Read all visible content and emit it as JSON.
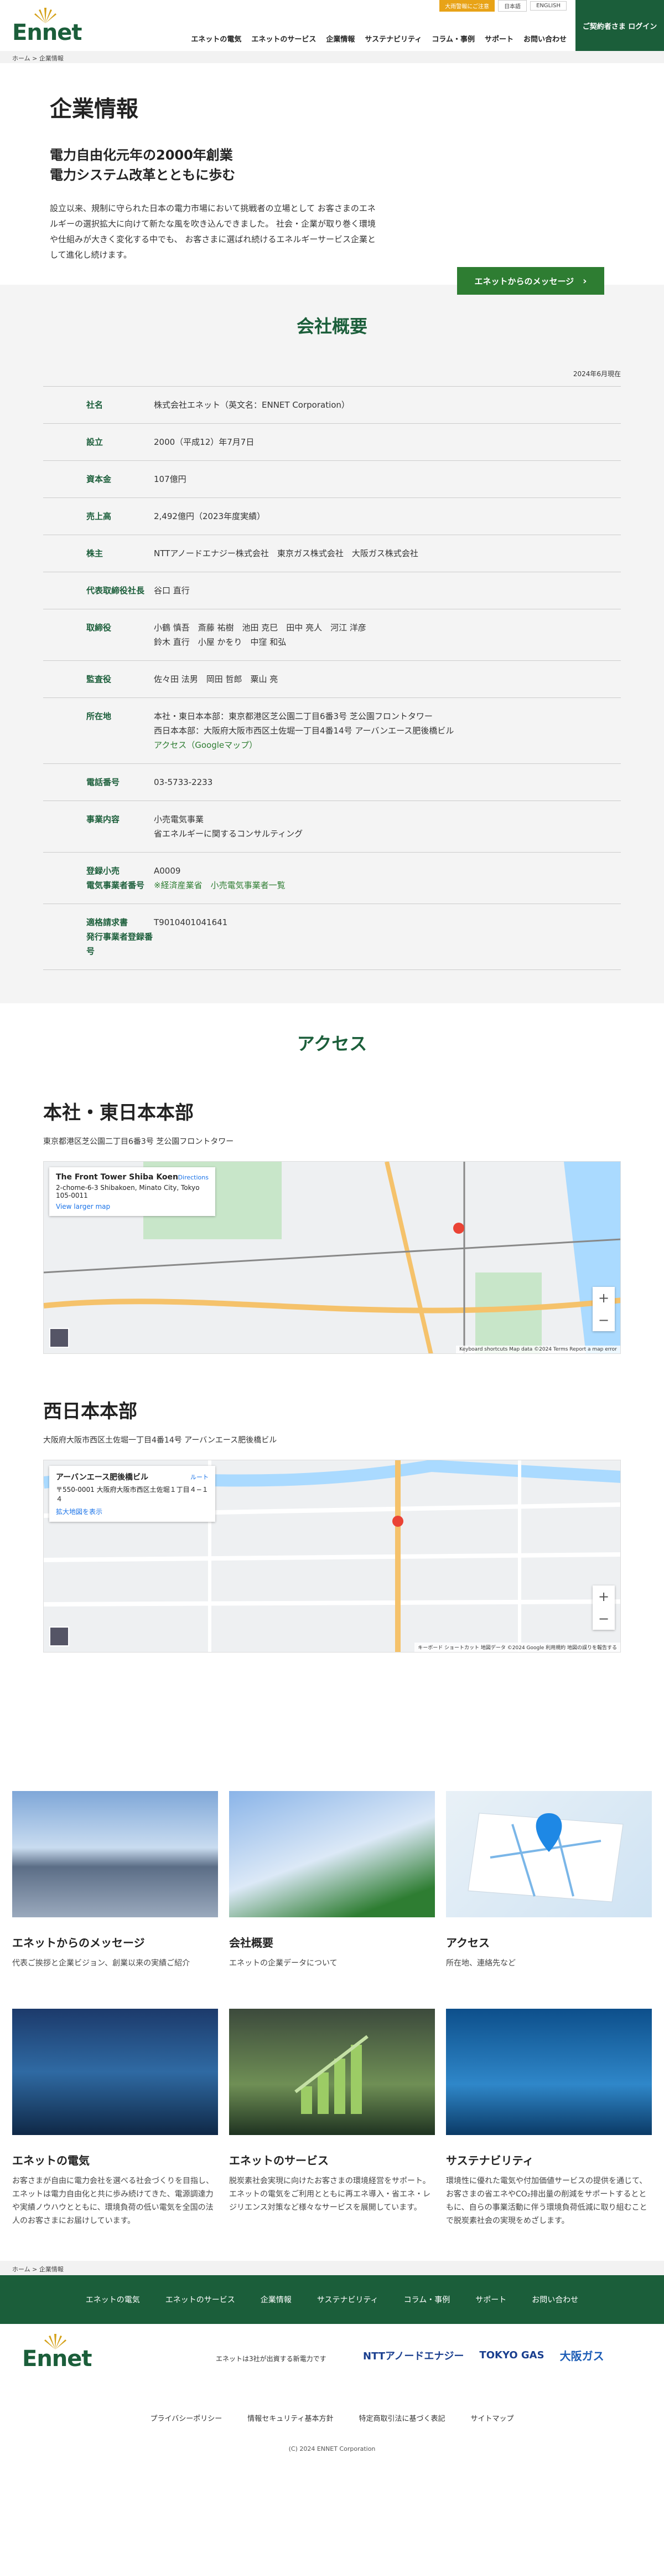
{
  "header": {
    "logo_text": "Ennet",
    "top_notice": "大雨警報にご注意",
    "lang_jp": "日本語",
    "lang_en": "ENGLISH",
    "nav": [
      "エネットの電気",
      "エネットのサービス",
      "企業情報",
      "サステナビリティ",
      "コラム・事例",
      "サポート",
      "お問い合わせ"
    ],
    "login": "ご契約者さま ログイン"
  },
  "breadcrumb": {
    "home": "ホーム",
    "sep": ">",
    "current": "企業情報"
  },
  "hero": {
    "title": "企業情報",
    "subtitle1": "電力自由化元年の2000年創業",
    "subtitle2": "電力システム改革とともに歩む",
    "body": "設立以来、規制に守られた日本の電力市場において挑戦者の立場として お客さまのエネルギーの選択拡大に向けて新たな風を吹き込んできました。 社会・企業が取り巻く環境や仕組みが大きく変化する中でも、 お客さまに選ばれ続けるエネルギーサービス企業として進化し続けます。",
    "button": "エネットからのメッセージ"
  },
  "overview": {
    "title": "会社概要",
    "date": "2024年6月現在",
    "rows": [
      {
        "k": "社名",
        "v": [
          "株式会社エネット（英文名：ENNET Corporation）"
        ]
      },
      {
        "k": "設立",
        "v": [
          "2000（平成12）年7月7日"
        ]
      },
      {
        "k": "資本金",
        "v": [
          "107億円"
        ]
      },
      {
        "k": "売上高",
        "v": [
          "2,492億円（2023年度実績）"
        ]
      },
      {
        "k": "株主",
        "v": [
          "NTTアノードエナジー株式会社　東京ガス株式会社　大阪ガス株式会社"
        ]
      },
      {
        "k": "代表取締役社長",
        "v": [
          "谷口 直行"
        ]
      },
      {
        "k": "取締役",
        "v": [
          "小鶴 慎吾　斎藤 祐樹　池田 克巳　田中 亮人　河江 洋彦",
          "鈴木 直行　小屋 かをり　中窪 和弘"
        ]
      },
      {
        "k": "監査役",
        "v": [
          "佐々田 法男　岡田 哲郎　粟山 亮"
        ]
      },
      {
        "k": "所在地",
        "v": [
          "本社・東日本本部：東京都港区芝公園二丁目6番3号 芝公園フロントタワー",
          "西日本本部：大阪府大阪市西区土佐堀一丁目4番14号 アーバンエース肥後橋ビル"
        ],
        "link": "アクセス（Googleマップ）"
      },
      {
        "k": "電話番号",
        "v": [
          "03-5733-2233"
        ]
      },
      {
        "k": "事業内容",
        "v": [
          "小売電気事業",
          "省エネルギーに関するコンサルティング"
        ]
      },
      {
        "k": "登録小売\n電気事業者番号",
        "v": [
          "A0009"
        ],
        "link": "※経済産業省　小売電気事業者一覧"
      },
      {
        "k": "適格請求書\n発行事業者登録番号",
        "v": [
          "T9010401041641"
        ]
      }
    ]
  },
  "access": {
    "title": "アクセス",
    "locations": [
      {
        "name": "本社・東日本本部",
        "addr": "東京都港区芝公園二丁目6番3号 芝公園フロントタワー",
        "card_title": "The Front Tower Shiba Koen",
        "card_addr": "2-chome-6-3 Shibakoen, Minato City, Tokyo 105-0011",
        "card_link": "View larger map",
        "card_dir": "Directions",
        "attr": "Keyboard shortcuts   Map data ©2024   Terms   Report a map error"
      },
      {
        "name": "西日本本部",
        "addr": "大阪府大阪市西区土佐堀一丁目4番14号 アーバンエース肥後橋ビル",
        "card_title": "アーバンエース肥後橋ビル",
        "card_addr": "〒550-0001 大阪府大阪市西区土佐堀１丁目４−１４",
        "card_link": "拡大地図を表示",
        "card_dir": "ルート",
        "attr": "キーボード ショートカット   地図データ ©2024 Google   利用規約   地図の誤りを報告する"
      }
    ]
  },
  "cards": [
    {
      "title": "エネットからのメッセージ",
      "desc": "代表ご挨拶と企業ビジョン、創業以来の実績ご紹介"
    },
    {
      "title": "会社概要",
      "desc": "エネットの企業データについて"
    },
    {
      "title": "アクセス",
      "desc": "所在地、連絡先など"
    },
    {
      "title": "エネットの電気",
      "desc": "お客さまが自由に電力会社を選べる社会づくりを目指し、エネットは電力自由化と共に歩み続けてきた、電源調達力や実績ノウハウとともに、環境負荷の低い電気を全国の法人のお客さまにお届けしています。"
    },
    {
      "title": "エネットのサービス",
      "desc": "脱炭素社会実現に向けたお客さまの環境経営をサポート。エネットの電気をご利用とともに再エネ導入・省エネ・レジリエンス対策など様々なサービスを展開しています。"
    },
    {
      "title": "サステナビリティ",
      "desc": "環境性に優れた電気や付加価値サービスの提供を通じて、お客さまの省エネやCO₂排出量の削減をサポートするとともに、自らの事業活動に伴う環境負荷低減に取り組むことで脱炭素社会の実現をめざします。"
    }
  ],
  "footer": {
    "nav": [
      "エネットの電気",
      "エネットのサービス",
      "企業情報",
      "サステナビリティ",
      "コラム・事例",
      "サポート",
      "お問い合わせ"
    ],
    "note": "エネットは3社が出資する新電力です",
    "groups": [
      "NTTアノードエナジー",
      "TOKYO GAS",
      "大阪ガス"
    ],
    "links": [
      "プライバシーポリシー",
      "情報セキュリティ基本方針",
      "特定商取引法に基づく表記",
      "サイトマップ"
    ],
    "copyright": "(C) 2024 ENNET Corporation"
  },
  "colors": {
    "brand": "#1b5e3a",
    "accent": "#2e7d32",
    "notice": "#e8a317"
  }
}
